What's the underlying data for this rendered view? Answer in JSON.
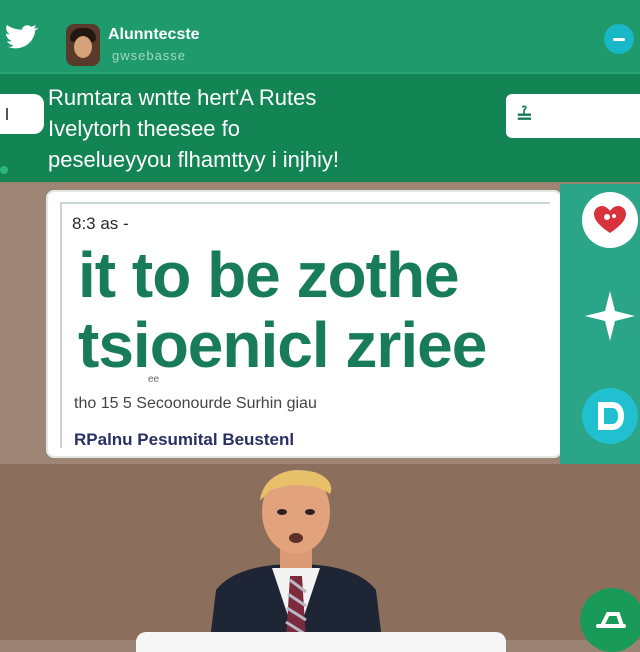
{
  "header": {
    "display_name": "Alunntecste",
    "handle": "gwsebasse",
    "bird_icon": "bird-icon",
    "action_icon": "minus-icon"
  },
  "compose": {
    "lines": [
      "Rumtara wntte hert'A Rutes",
      "Ivelytorh theesee fo",
      "peselueyyou flhamttyy i injhiy!"
    ],
    "input_glyph": "≟"
  },
  "card": {
    "meta": "8:3 as -",
    "headline": [
      "it to be zothe",
      "tsioenicl zriee"
    ],
    "tiny": "ee",
    "caption": "tho 15 5 Secoonourde Surhin giau",
    "footer": "RPalnu Pesumital  Beustenl"
  },
  "rail": {
    "heart_icon": "heart-icon",
    "star_icon": "star-icon",
    "reply_icon": "reply-icon"
  },
  "fab": {
    "icon": "compose-icon"
  },
  "colors": {
    "brand_green": "#1e9a6c",
    "dark_green": "#138555",
    "headline_green": "#187c5a",
    "accent_cyan": "#21c0d0"
  }
}
